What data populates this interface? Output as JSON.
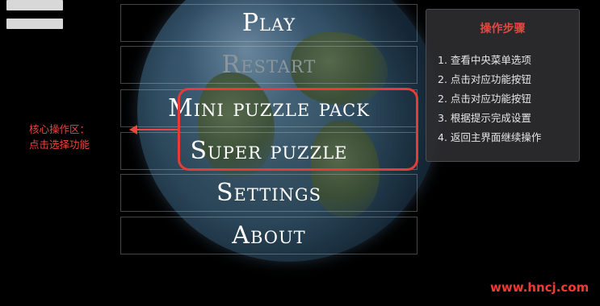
{
  "menu": {
    "items": [
      {
        "label": "Play",
        "state": "enabled"
      },
      {
        "label": "Restart",
        "state": "disabled"
      },
      {
        "label": "Mini puzzle pack",
        "state": "enabled"
      },
      {
        "label": "Super puzzle",
        "state": "enabled"
      },
      {
        "label": "Settings",
        "state": "enabled"
      },
      {
        "label": "About",
        "state": "enabled"
      }
    ]
  },
  "callout": {
    "line1": "核心操作区：",
    "line2": "点击选择功能"
  },
  "steps_panel": {
    "title": "操作步骤",
    "items": [
      "1. 查看中央菜单选项",
      "2. 点击对应功能按钮",
      "2. 点击对应功能按钮",
      "3. 根据提示完成设置",
      "4. 返回主界面继续操作"
    ]
  },
  "watermark": "www.hncj.com",
  "colors": {
    "annotation_red": "#e8463f",
    "menu_text": "#ffffff",
    "menu_disabled_text": "#8a969b",
    "background": "#000000"
  }
}
